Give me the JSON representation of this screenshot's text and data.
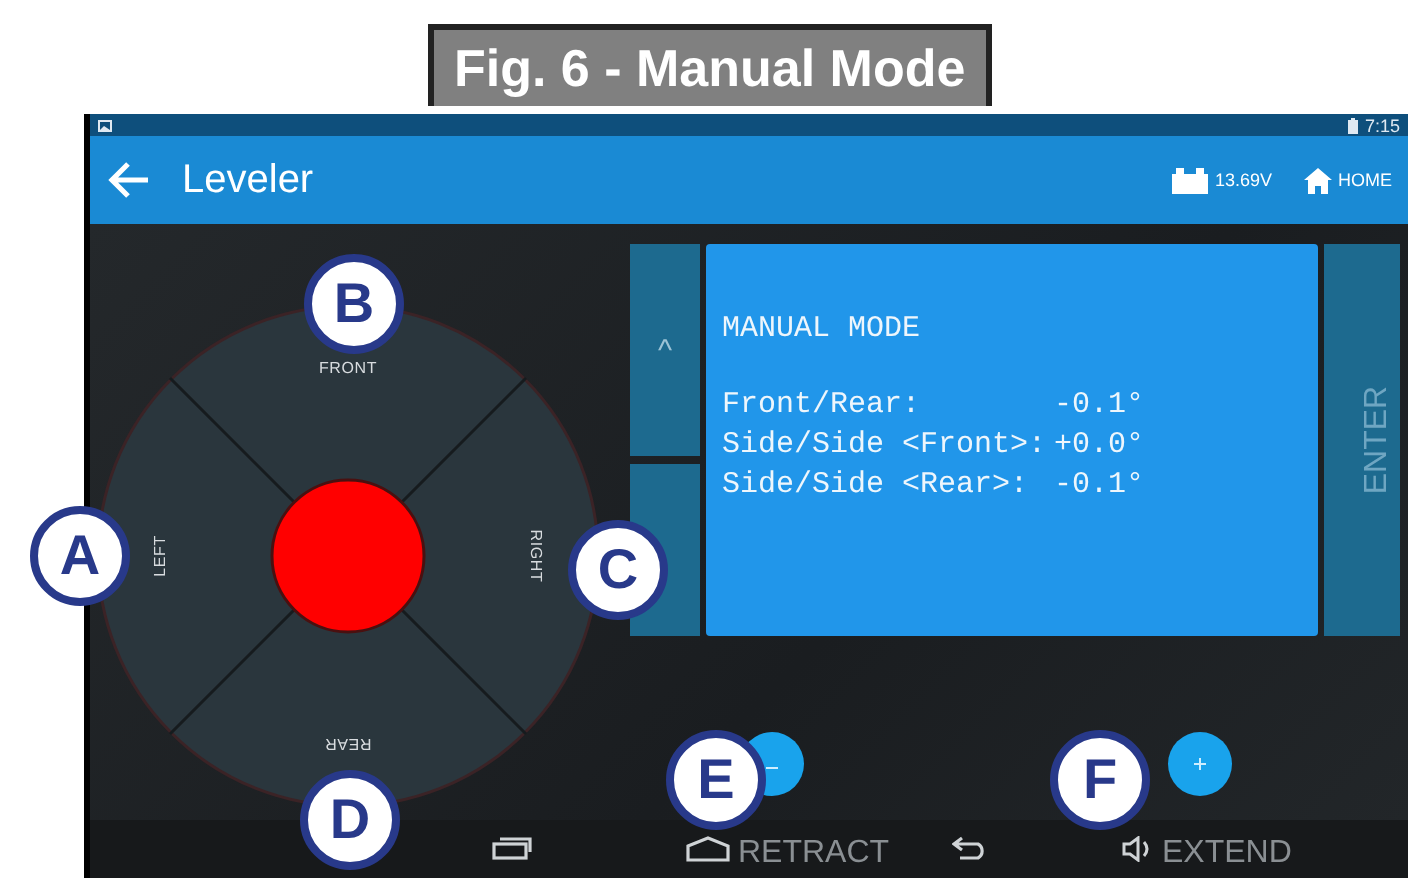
{
  "figure_title": "Fig. 6 - Manual Mode",
  "status_bar": {
    "time": "7:15"
  },
  "app_bar": {
    "title": "Leveler",
    "voltage": "13.69V",
    "home": "HOME"
  },
  "dial": {
    "front": "FRONT",
    "left": "LEFT",
    "right": "RIGHT",
    "rear": "REAR"
  },
  "panel": {
    "up_button": "^",
    "heading": "MANUAL MODE",
    "readings": [
      {
        "label": "Front/Rear:",
        "value": "-0.1°"
      },
      {
        "label": "Side/Side <Front>:",
        "value": "+0.0°"
      },
      {
        "label": "Side/Side <Rear>:",
        "value": "-0.1°"
      }
    ],
    "enter_button": "ENTER"
  },
  "adjust_buttons": [
    {
      "kind": "minus"
    },
    {
      "kind": "plus"
    }
  ],
  "action_labels": [
    "RETRACT",
    "EXTEND"
  ],
  "callouts": [
    "A",
    "B",
    "C",
    "D",
    "E",
    "F"
  ]
}
